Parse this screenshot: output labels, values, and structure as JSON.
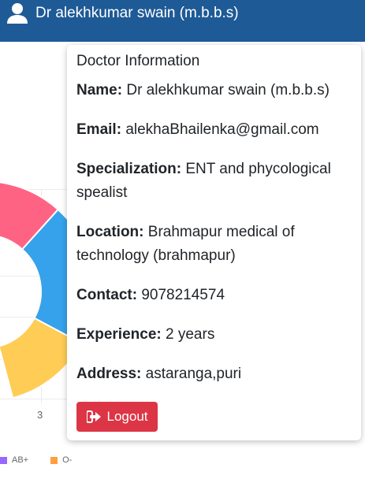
{
  "header": {
    "user_name": "Dr alekhkumar swain (m.b.b.s)"
  },
  "panel": {
    "title": "Doctor Information",
    "fields": [
      {
        "label": "Name:",
        "value": "Dr alekhkumar swain (m.b.b.s)"
      },
      {
        "label": "Email:",
        "value": "alekhaBhailenka@gmail.com"
      },
      {
        "label": "Specialization:",
        "value": "ENT and phycological spealist"
      },
      {
        "label": "Location:",
        "value": "Brahmapur medical of technology (brahmapur)"
      },
      {
        "label": "Contact:",
        "value": "9078214574"
      },
      {
        "label": "Experience:",
        "value": "2 years"
      },
      {
        "label": "Address:",
        "value": "astaranga,puri"
      }
    ],
    "logout_label": "Logout"
  },
  "chart": {
    "x_tick": "3",
    "legend": [
      {
        "label": "AB+",
        "color": "#9966ff"
      },
      {
        "label": "O-",
        "color": "#ff9f40"
      }
    ],
    "slice_colors": [
      "#ff6384",
      "#36a2eb",
      "#ffcd56"
    ]
  },
  "colors": {
    "header_bg": "#1e5a96",
    "logout_bg": "#dc3545"
  }
}
